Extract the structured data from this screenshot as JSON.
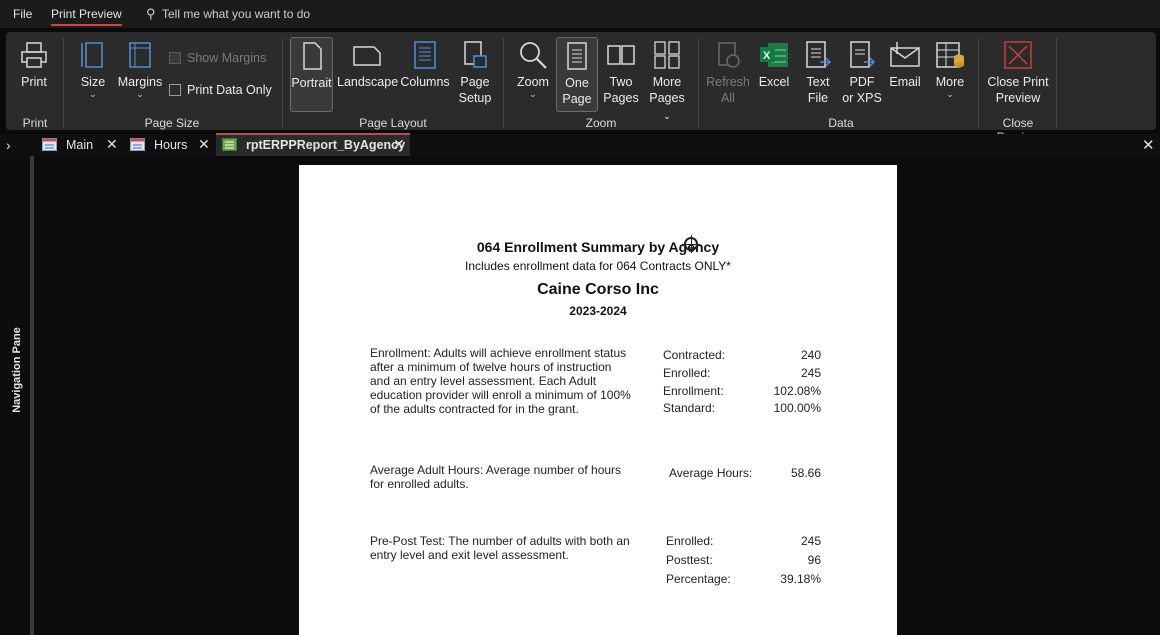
{
  "menubar": {
    "file": "File",
    "print_preview": "Print Preview",
    "tell_me": "Tell me what you want to do"
  },
  "ribbon": {
    "print_group": {
      "print": "Print",
      "label": "Print"
    },
    "page_size_group": {
      "size": "Size",
      "margins": "Margins",
      "show_margins": "Show Margins",
      "print_data_only": "Print Data Only",
      "label": "Page Size"
    },
    "page_layout_group": {
      "portrait": "Portrait",
      "landscape": "Landscape",
      "columns": "Columns",
      "page": "Page",
      "setup": "Setup",
      "label": "Page Layout"
    },
    "zoom_group": {
      "zoom": "Zoom",
      "one": "One",
      "one_page": "Page",
      "two": "Two",
      "two_pages": "Pages",
      "more": "More",
      "more_pages": "Pages",
      "label": "Zoom"
    },
    "data_group": {
      "refresh": "Refresh",
      "all": "All",
      "excel": "Excel",
      "text": "Text",
      "file": "File",
      "pdf": "PDF",
      "or_xps": "or XPS",
      "email": "Email",
      "more": "More",
      "label": "Data"
    },
    "close_group": {
      "close_print": "Close Print",
      "preview": "Preview",
      "label": "Close Preview"
    }
  },
  "tabs": [
    {
      "label": "Main"
    },
    {
      "label": "Hours"
    },
    {
      "label": "rptERPPReport_ByAgency"
    }
  ],
  "nav_pane": {
    "label": "Navigation Pane"
  },
  "report": {
    "title": "064 Enrollment Summary by Agency",
    "subtitle": "Includes enrollment data for 064 Contracts ONLY*",
    "agency": "Caine Corso Inc",
    "year": "2023-2024",
    "enrollment": {
      "desc_lines": [
        "Enrollment:  Adults will achieve enrollment status",
        "after a minimum of twelve hours of instruction",
        "and an entry level assessment.  Each Adult",
        "education provider will enroll a minimum of 100%",
        "of the adults contracted for in the grant."
      ],
      "metrics": [
        {
          "label": "Contracted:",
          "value": "240"
        },
        {
          "label": "Enrolled:",
          "value": "245"
        },
        {
          "label": "Enrollment:",
          "value": "102.08%"
        },
        {
          "label": "Standard:",
          "value": "100.00%"
        }
      ]
    },
    "hours": {
      "desc_lines": [
        "Average Adult Hours:  Average number of hours",
        "for enrolled adults."
      ],
      "metrics": [
        {
          "label": "Average Hours:",
          "value": "58.66"
        }
      ]
    },
    "prepost": {
      "desc_lines": [
        "Pre-Post Test:  The number of adults with both an",
        "entry level and exit level assessment."
      ],
      "metrics": [
        {
          "label": "Enrolled:",
          "value": "245"
        },
        {
          "label": "Posttest:",
          "value": "96"
        },
        {
          "label": "Percentage:",
          "value": "39.18%"
        }
      ]
    }
  }
}
